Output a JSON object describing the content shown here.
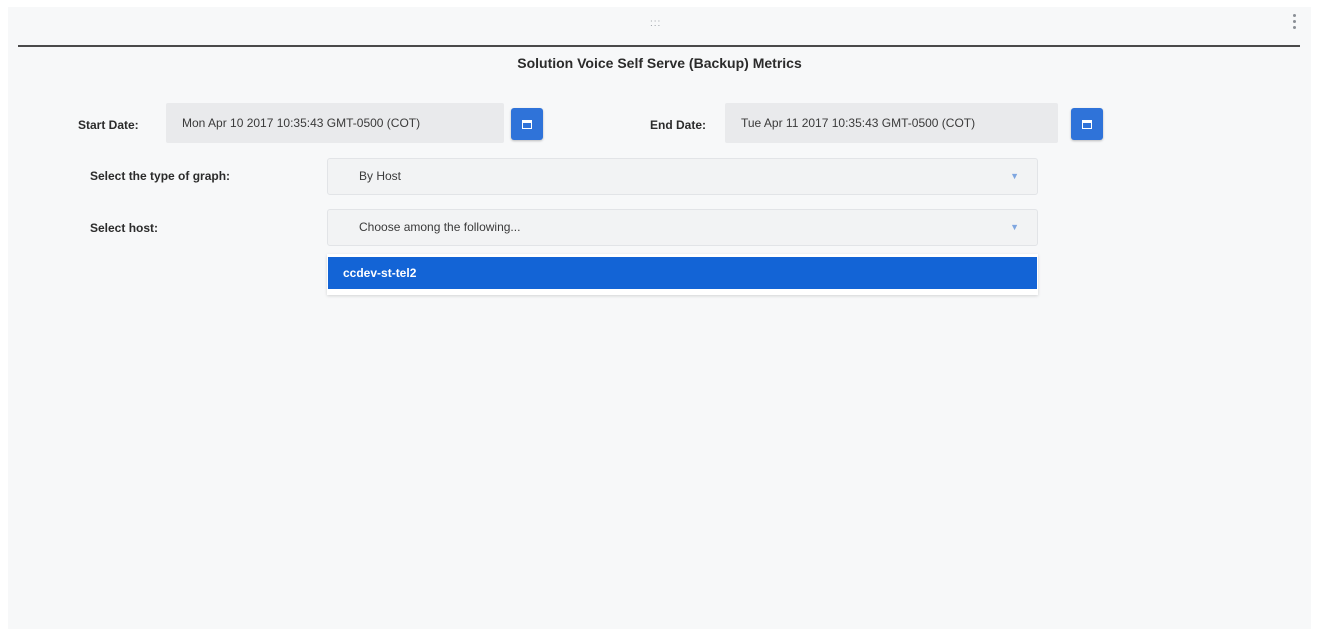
{
  "toolbar": {
    "drag_handle_icon": "drag-handle-icon",
    "menu_icon": "kebab-menu-icon"
  },
  "page": {
    "title": "Solution Voice Self Serve (Backup) Metrics"
  },
  "start_date": {
    "label": "Start Date:",
    "value": "Mon Apr 10 2017 10:35:43 GMT-0500 (COT)",
    "button_icon": "calendar-icon"
  },
  "end_date": {
    "label": "End Date:",
    "value": "Tue Apr 11 2017 10:35:43 GMT-0500 (COT)",
    "button_icon": "calendar-icon"
  },
  "graph_type": {
    "label": "Select the type of graph:",
    "selected": "By Host"
  },
  "host": {
    "label": "Select host:",
    "placeholder": "Choose among the following...",
    "options": [
      "ccdev-st-tel2"
    ],
    "highlighted_index": 0
  },
  "colors": {
    "accent": "#1364d6",
    "button": "#2f73d9",
    "panel_background": "#f7f8f9"
  }
}
